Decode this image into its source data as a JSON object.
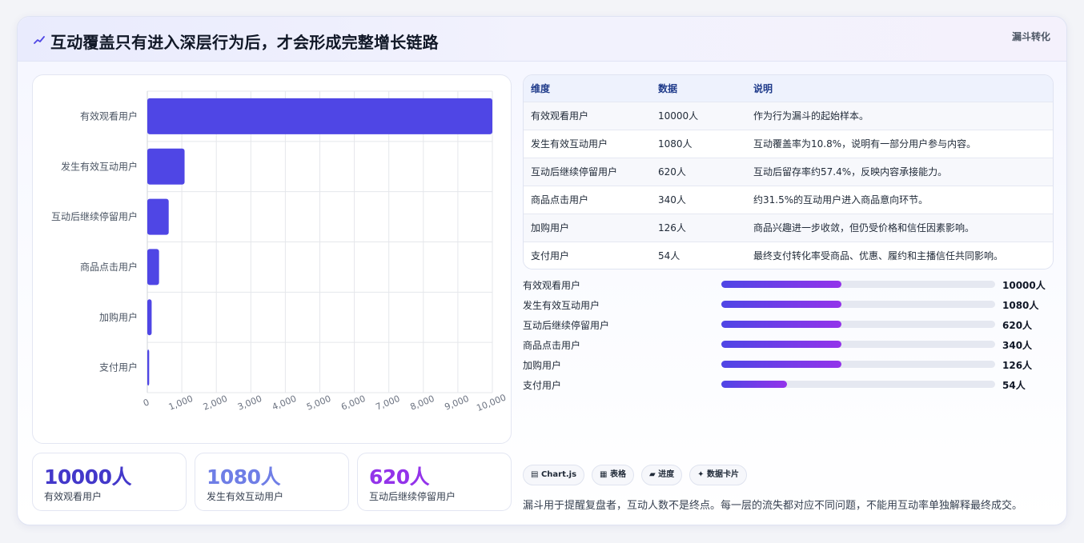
{
  "header": {
    "icon": "trend-line-icon",
    "title": "互动覆盖只有进入深层行为后，才会形成完整增长链路",
    "tag": "漏斗转化"
  },
  "colors": {
    "bar": "#4f46e5",
    "gradient_start": "#4f46e5",
    "gradient_end": "#9333ea",
    "stat1": "#4338ca",
    "stat2": "#6f7ee6",
    "stat3": "#9333ea"
  },
  "chart_data": {
    "type": "bar",
    "orientation": "horizontal",
    "categories": [
      "有效观看用户",
      "发生有效互动用户",
      "互动后继续停留用户",
      "商品点击用户",
      "加购用户",
      "支付用户"
    ],
    "values": [
      10000,
      1080,
      620,
      340,
      126,
      54
    ],
    "xlim": [
      0,
      10000
    ],
    "xticks": [
      "0",
      "1,000",
      "2,000",
      "3,000",
      "4,000",
      "5,000",
      "6,000",
      "7,000",
      "8,000",
      "9,000",
      "10,000"
    ],
    "grid": true,
    "legend": "none"
  },
  "stats": [
    {
      "value": "10000人",
      "label": "有效观看用户"
    },
    {
      "value": "1080人",
      "label": "发生有效互动用户"
    },
    {
      "value": "620人",
      "label": "互动后继续停留用户"
    }
  ],
  "table": {
    "headers": [
      "维度",
      "数据",
      "说明"
    ],
    "rows": [
      [
        "有效观看用户",
        "10000人",
        "作为行为漏斗的起始样本。"
      ],
      [
        "发生有效互动用户",
        "1080人",
        "互动覆盖率为10.8%，说明有一部分用户参与内容。"
      ],
      [
        "互动后继续停留用户",
        "620人",
        "互动后留存率约57.4%，反映内容承接能力。"
      ],
      [
        "商品点击用户",
        "340人",
        "约31.5%的互动用户进入商品意向环节。"
      ],
      [
        "加购用户",
        "126人",
        "商品兴趣进一步收敛，但仍受价格和信任因素影响。"
      ],
      [
        "支付用户",
        "54人",
        "最终支付转化率受商品、优惠、履约和主播信任共同影响。"
      ]
    ]
  },
  "progress": [
    {
      "label": "有效观看用户",
      "value": "10000人",
      "fill": 0.44
    },
    {
      "label": "发生有效互动用户",
      "value": "1080人",
      "fill": 0.44
    },
    {
      "label": "互动后继续停留用户",
      "value": "620人",
      "fill": 0.44
    },
    {
      "label": "商品点击用户",
      "value": "340人",
      "fill": 0.44
    },
    {
      "label": "加购用户",
      "value": "126人",
      "fill": 0.44
    },
    {
      "label": "支付用户",
      "value": "54人",
      "fill": 0.24
    }
  ],
  "chips": [
    {
      "icon": "chart-icon",
      "glyph": "▤",
      "label": "Chart.js"
    },
    {
      "icon": "table-icon",
      "glyph": "▦",
      "label": "表格"
    },
    {
      "icon": "progress-icon",
      "glyph": "▰",
      "label": "进度"
    },
    {
      "icon": "sparkle-icon",
      "glyph": "✦",
      "label": "数据卡片"
    }
  ],
  "footnote": "漏斗用于提醒复盘者，互动人数不是终点。每一层的流失都对应不同问题，不能用互动率单独解释最终成交。"
}
